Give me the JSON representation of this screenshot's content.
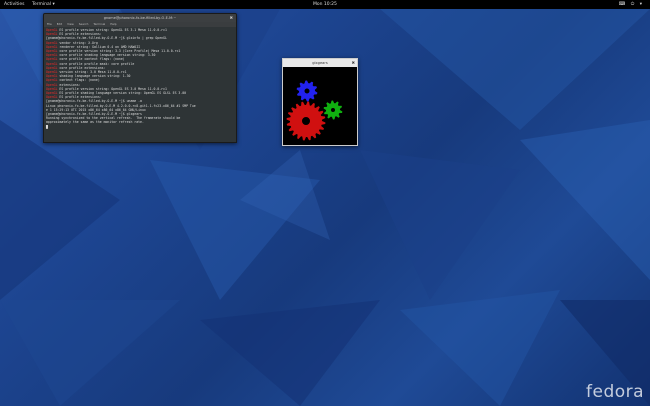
{
  "topbar": {
    "activities": "Activities",
    "app_menu": "Terminal ▾",
    "clock": "Mon 10:25",
    "tray_icons": "⌨ ⏻ ▾"
  },
  "terminal": {
    "title": "gnome@phoronix-fx-be-filled-by-O-E-M:~",
    "menu": [
      "File",
      "Edit",
      "View",
      "Search",
      "Terminal",
      "Help"
    ],
    "lines": [
      {
        "p": "OpenGL",
        "t": " ES profile version string: OpenGL ES 3.1 Mesa 11.0.0-rc1"
      },
      {
        "p": "OpenGL",
        "t": " ES profile extensions:"
      },
      {
        "p": "",
        "t": "[gnome@phoronix-fx-be-filled-by-O-E-M ~]$ glxinfo | grep OpenGL"
      },
      {
        "p": "OpenGL",
        "t": " vendor string: X.Org"
      },
      {
        "p": "OpenGL",
        "t": " renderer string: Gallium 0.4 on AMD HAWAII"
      },
      {
        "p": "OpenGL",
        "t": " core profile version string: 3.3 (Core Profile) Mesa 11.0.0-rc1"
      },
      {
        "p": "OpenGL",
        "t": " core profile shading language version string: 3.30"
      },
      {
        "p": "OpenGL",
        "t": " core profile context flags: (none)"
      },
      {
        "p": "OpenGL",
        "t": " core profile profile mask: core profile"
      },
      {
        "p": "OpenGL",
        "t": " core profile extensions:"
      },
      {
        "p": "OpenGL",
        "t": " version string: 3.0 Mesa 11.0.0-rc1"
      },
      {
        "p": "OpenGL",
        "t": " shading language version string: 1.30"
      },
      {
        "p": "OpenGL",
        "t": " context flags: (none)"
      },
      {
        "p": "OpenGL",
        "t": " extensions:"
      },
      {
        "p": "OpenGL",
        "t": " ES profile version string: OpenGL ES 3.0 Mesa 11.0.0-rc1"
      },
      {
        "p": "OpenGL",
        "t": " ES profile shading language version string: OpenGL ES GLSL ES 3.00"
      },
      {
        "p": "OpenGL",
        "t": " ES profile extensions:"
      },
      {
        "p": "",
        "t": "[gnome@phoronix-fx-be-filled-by-O-E-M ~]$ uname -a"
      },
      {
        "p": "",
        "t": "Linux phoronix-fx-be-filled-by-O-E-M 4.2.0-0.rc8.git1.1.fc23.x86_64 #1 SMP Tue"
      },
      {
        "p": "",
        "t": "e 1 15:29:13 UTC 2015 x86_64 x86_64 x86_64 GNU/Linux"
      },
      {
        "p": "",
        "t": "[gnome@phoronix-fx-be-filled-by-O-E-M ~]$ glxgears"
      },
      {
        "p": "",
        "t": "Running synchronized to the vertical refresh.  The framerate should be"
      },
      {
        "p": "",
        "t": "approximately the same as the monitor refresh rate."
      },
      {
        "p": "",
        "t": "█"
      }
    ]
  },
  "glxgears": {
    "title": "glxgears",
    "close": "✖",
    "gears": {
      "red": "#d01010",
      "green": "#10b010",
      "blue": "#2222ee"
    }
  },
  "terminal_close": "✖",
  "wallpaper": {
    "logo": "fedora"
  }
}
